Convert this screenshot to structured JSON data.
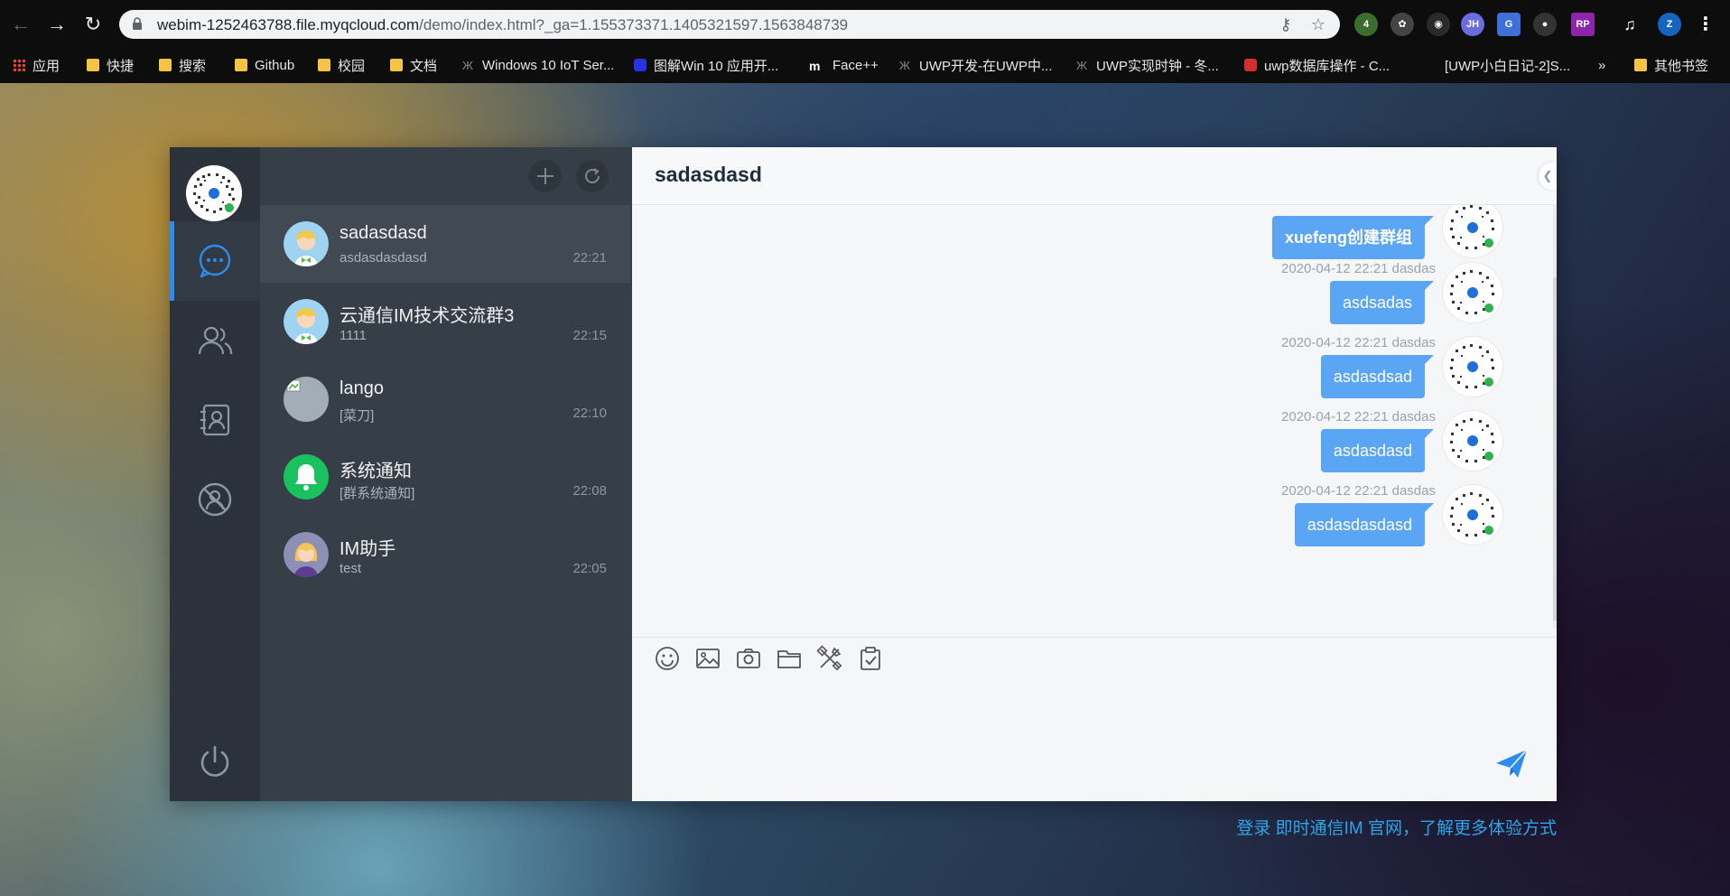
{
  "browser": {
    "url": "webim-1252463788.file.myqcloud.com",
    "url_rest": "/demo/index.html?_ga=1.155373371.1405321597.1563848739",
    "ext_badge": "4",
    "profile_initials": "JH",
    "user_initial": "Z",
    "bookmarks": [
      {
        "label": "应用",
        "icon": "apps-grid-icon"
      },
      {
        "label": "快捷",
        "icon": "folder-icon"
      },
      {
        "label": "搜索",
        "icon": "folder-icon"
      },
      {
        "label": "Github",
        "icon": "folder-icon"
      },
      {
        "label": "校园",
        "icon": "folder-icon"
      },
      {
        "label": "文档",
        "icon": "folder-icon"
      },
      {
        "label": "Windows 10 IoT Ser...",
        "icon": "site-icon"
      },
      {
        "label": "图解Win 10 应用开...",
        "icon": "baidu-icon"
      },
      {
        "label": "Face++",
        "icon": "m-icon"
      },
      {
        "label": "UWP开发-在UWP中...",
        "icon": "site-icon"
      },
      {
        "label": "UWP实现时钟 - 冬...",
        "icon": "site-icon"
      },
      {
        "label": "uwp数据库操作 - C...",
        "icon": "c-icon"
      },
      {
        "label": "[UWP小白日记-2]S...",
        "icon": "none"
      },
      {
        "label": "»",
        "icon": "none"
      },
      {
        "label": "其他书签",
        "icon": "folder-icon"
      }
    ]
  },
  "app": {
    "conversations": [
      {
        "name": "sadasdasd",
        "preview": "asdasdasdasd",
        "time": "22:21",
        "avatar": "cartoon-boy",
        "active": true
      },
      {
        "name": "云通信IM技术交流群3",
        "preview": "1111",
        "time": "22:15",
        "avatar": "cartoon-boy",
        "active": false
      },
      {
        "name": "lango",
        "preview": "[菜刀]",
        "time": "22:10",
        "avatar": "broken-image",
        "active": false
      },
      {
        "name": "系统通知",
        "preview": "[群系统通知]",
        "time": "22:08",
        "avatar": "bell",
        "active": false
      },
      {
        "name": "IM助手",
        "preview": "test",
        "time": "22:05",
        "avatar": "cartoon-girl",
        "active": false
      }
    ],
    "chat": {
      "title": "sadasdasd",
      "messages": [
        {
          "meta": "",
          "text": "xuefeng创建群组",
          "bold": true
        },
        {
          "meta": "2020-04-12 22:21 dasdas",
          "text": "asdsadas",
          "bold": false
        },
        {
          "meta": "2020-04-12 22:21 dasdas",
          "text": "asdasdsad",
          "bold": false
        },
        {
          "meta": "2020-04-12 22:21 dasdas",
          "text": "asdasdasd",
          "bold": false
        },
        {
          "meta": "2020-04-12 22:21 dasdas",
          "text": "asdasdasdasd",
          "bold": false
        }
      ]
    },
    "footer_link": "登录 即时通信IM 官网，了解更多体验方式",
    "colors": {
      "accent": "#2d8cf0",
      "bubble": "#5aa6f5",
      "rail": "#2b323b",
      "list": "#363e47",
      "link": "#2fa4e7"
    }
  }
}
